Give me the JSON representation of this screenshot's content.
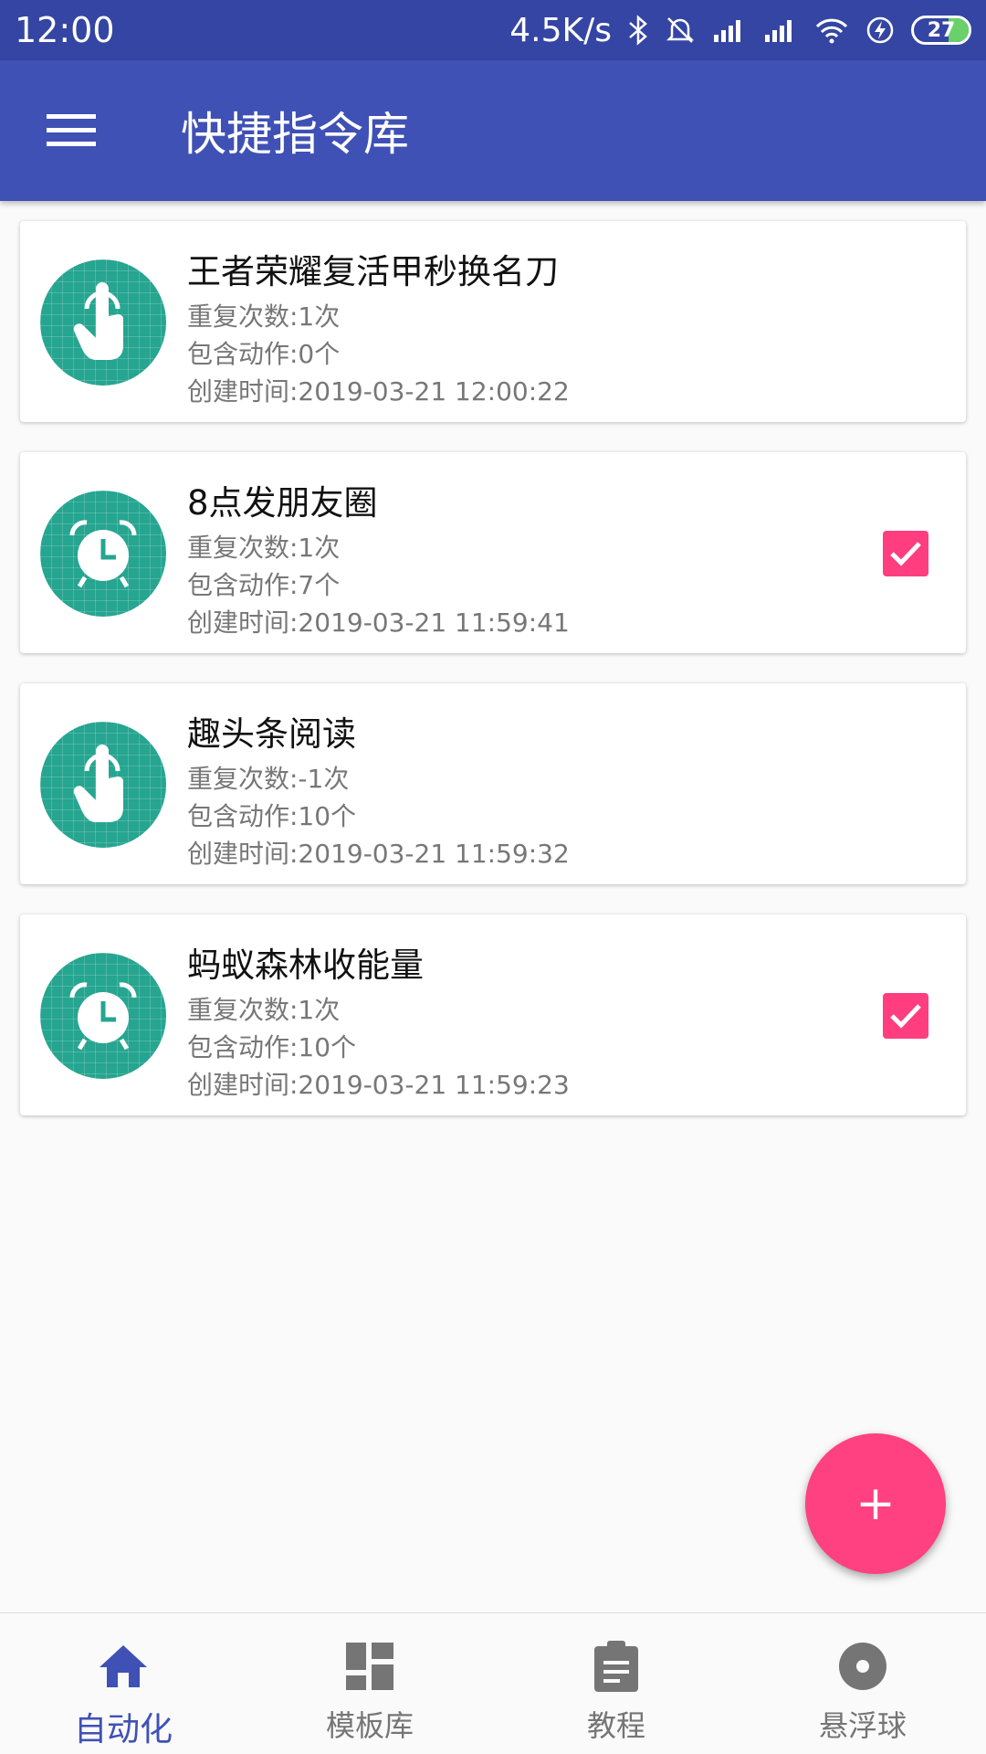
{
  "status_bar": {
    "time": "12:00",
    "speed": "4.5K/s",
    "battery": "27"
  },
  "app_bar": {
    "title": "快捷指令库"
  },
  "tasks": [
    {
      "title": "王者荣耀复活甲秒换名刀",
      "repeat": "重复次数:1次",
      "actions": "包含动作:0个",
      "created": "创建时间:2019-03-21 12:00:22",
      "icon": "touch-hand",
      "checked": false
    },
    {
      "title": "8点发朋友圈",
      "repeat": "重复次数:1次",
      "actions": "包含动作:7个",
      "created": "创建时间:2019-03-21 11:59:41",
      "icon": "alarm-clock",
      "checked": true
    },
    {
      "title": "趣头条阅读",
      "repeat": "重复次数:-1次",
      "actions": "包含动作:10个",
      "created": "创建时间:2019-03-21 11:59:32",
      "icon": "touch-hand",
      "checked": false
    },
    {
      "title": "蚂蚁森林收能量",
      "repeat": "重复次数:1次",
      "actions": "包含动作:10个",
      "created": "创建时间:2019-03-21 11:59:23",
      "icon": "alarm-clock",
      "checked": true
    }
  ],
  "fab": {
    "label": "+"
  },
  "bottom_nav": [
    {
      "label": "自动化",
      "icon": "home",
      "active": true
    },
    {
      "label": "模板库",
      "icon": "dashboard",
      "active": false
    },
    {
      "label": "教程",
      "icon": "clipboard",
      "active": false
    },
    {
      "label": "悬浮球",
      "icon": "disc",
      "active": false
    }
  ],
  "colors": {
    "status_bar": "#3445a3",
    "app_bar": "#3f51b5",
    "accent": "#ff4081",
    "icon_bg": "#26a590",
    "nav_active": "#3f51b5",
    "nav_inactive": "#757575"
  }
}
